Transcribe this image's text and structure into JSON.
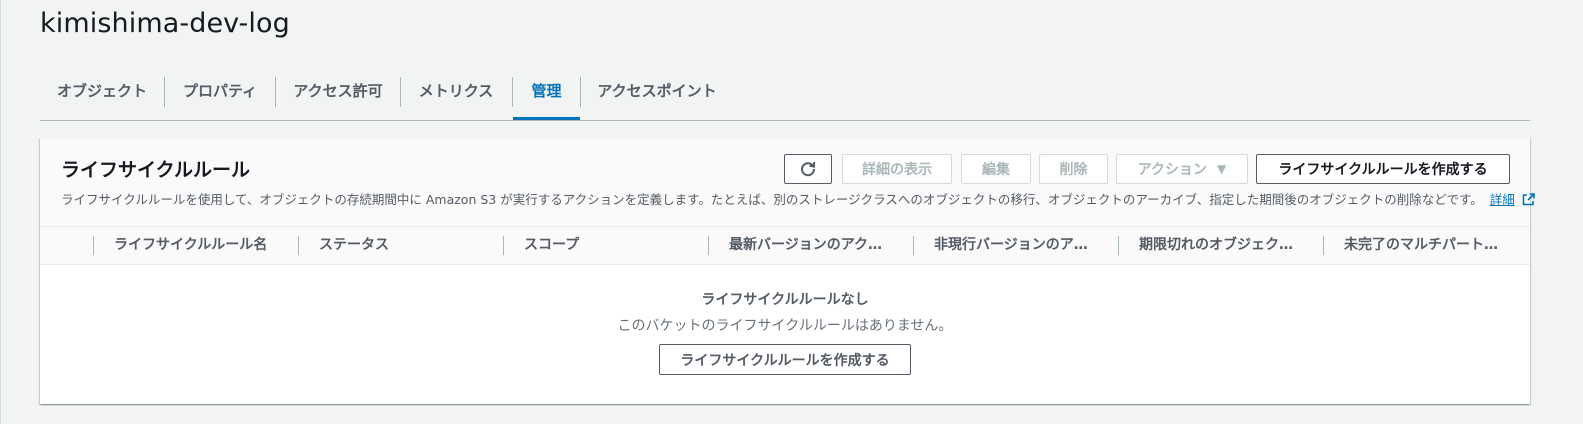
{
  "bucket": {
    "name": "kimishima-dev-log"
  },
  "tabs": [
    {
      "label": "オブジェクト"
    },
    {
      "label": "プロパティ"
    },
    {
      "label": "アクセス許可"
    },
    {
      "label": "メトリクス"
    },
    {
      "label": "管理",
      "active": true
    },
    {
      "label": "アクセスポイント"
    }
  ],
  "lifecycle": {
    "title": "ライフサイクルルール",
    "description": "ライフサイクルルールを使用して、オブジェクトの存続期間中に Amazon S3 が実行するアクションを定義します。たとえば、別のストレージクラスへのオブジェクトの移行、オブジェクトのアーカイブ、指定した期間後のオブジェクトの削除などです。",
    "details_link": "詳細",
    "buttons": {
      "refresh_icon": "refresh-icon",
      "view_details": "詳細の表示",
      "edit": "編集",
      "delete": "削除",
      "actions": "アクション",
      "actions_caret": "▼",
      "create": "ライフサイクルルールを作成する"
    },
    "columns": [
      "ライフサイクルルール名",
      "ステータス",
      "スコープ",
      "最新バージョンのアク…",
      "非現行バージョンのア…",
      "期限切れのオブジェク…",
      "未完了のマルチパート…"
    ],
    "empty": {
      "title": "ライフサイクルルールなし",
      "message": "このバケットのライフサイクルルールはありません。",
      "create_button": "ライフサイクルルールを作成する"
    }
  },
  "colors": {
    "accent": "#0073bb",
    "text": "#16191f",
    "muted": "#545b64",
    "disabled": "#aab7b8"
  }
}
